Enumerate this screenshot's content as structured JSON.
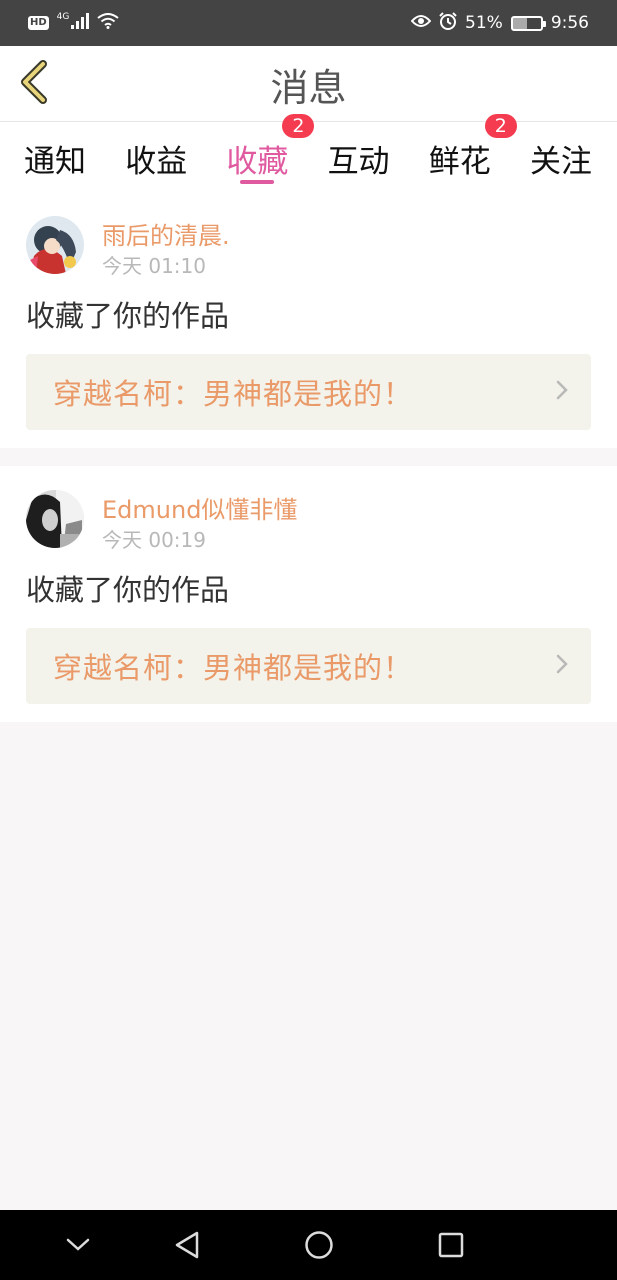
{
  "status_bar": {
    "network_badge": "HD",
    "network_type": "4G",
    "battery_percent": "51%",
    "battery_level": 0.51,
    "time": "9:56",
    "icons": [
      "hd-icon",
      "signal-icon",
      "wifi-icon",
      "eye-icon",
      "alarm-icon",
      "battery-icon"
    ]
  },
  "header": {
    "title": "消息",
    "back_icon": "chevron-left-icon",
    "back_color": "#e8d47a"
  },
  "tabs": [
    {
      "label": "通知",
      "badge": ""
    },
    {
      "label": "收益",
      "badge": ""
    },
    {
      "label": "收藏",
      "badge": "2",
      "active": true
    },
    {
      "label": "互动",
      "badge": ""
    },
    {
      "label": "鲜花",
      "badge": "2"
    },
    {
      "label": "关注",
      "badge": ""
    }
  ],
  "notifications": [
    {
      "username": "雨后的清晨.",
      "time": "今天 01:10",
      "action": "收藏了你的作品",
      "work_title": "穿越名柯：男神都是我的！",
      "avatar": "anime-avatar"
    },
    {
      "username": "Edmund似懂非懂",
      "time": "今天 00:19",
      "action": "收藏了你的作品",
      "work_title": "穿越名柯：男神都是我的！",
      "avatar": "photo-avatar"
    }
  ],
  "nav_bar": {
    "icons": [
      "chevron-down-icon",
      "back-triangle-icon",
      "home-circle-icon",
      "recents-square-icon"
    ]
  },
  "colors": {
    "accent": "#e05aa0",
    "username": "#ea9a68",
    "badge": "#f43b50",
    "link_bg": "#f3f3ec",
    "page_bg": "#f8f6f6"
  }
}
